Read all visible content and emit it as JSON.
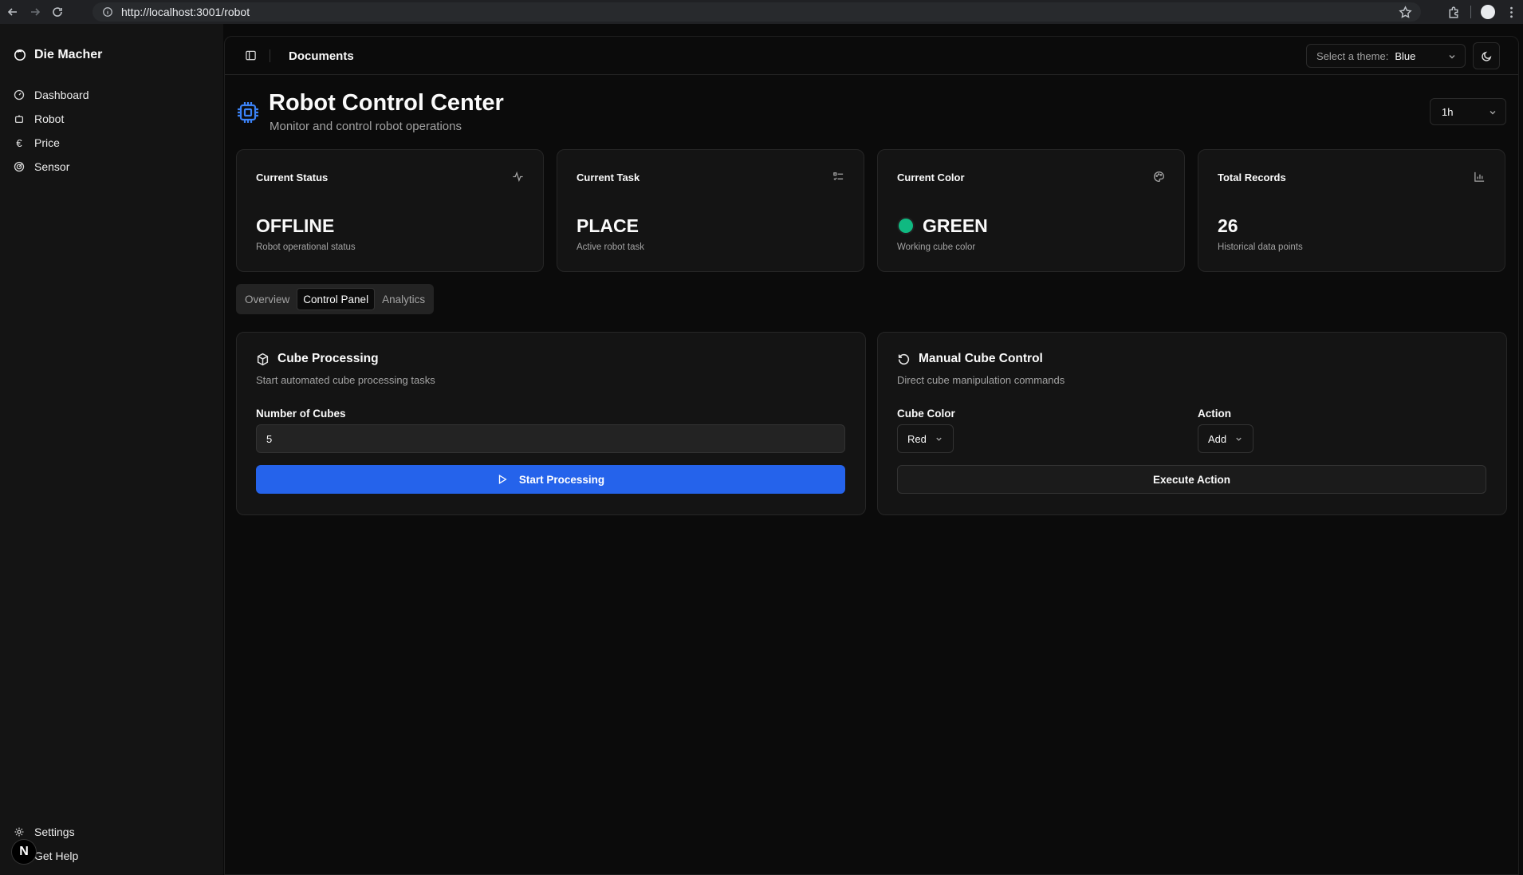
{
  "browser": {
    "url": "http://localhost:3001/robot"
  },
  "sidebar": {
    "brand": "Die Macher",
    "items": [
      {
        "label": "Dashboard",
        "icon": "gauge-icon"
      },
      {
        "label": "Robot",
        "icon": "bot-icon"
      },
      {
        "label": "Price",
        "icon": "euro-icon"
      },
      {
        "label": "Sensor",
        "icon": "radar-icon"
      }
    ],
    "footer": [
      {
        "label": "Settings",
        "icon": "gear-icon"
      },
      {
        "label": "Get Help",
        "icon": "help-icon"
      }
    ],
    "avatar_letter": "N"
  },
  "topbar": {
    "title": "Documents",
    "theme_label": "Select a theme:",
    "theme_value": "Blue"
  },
  "page": {
    "title": "Robot Control Center",
    "subtitle": "Monitor and control robot operations",
    "range": "1h",
    "accent_color": "#3b82f6"
  },
  "stats": [
    {
      "label": "Current Status",
      "value": "OFFLINE",
      "desc": "Robot operational status",
      "icon": "activity-icon"
    },
    {
      "label": "Current Task",
      "value": "PLACE",
      "desc": "Active robot task",
      "icon": "list-checks-icon"
    },
    {
      "label": "Current Color",
      "value": "GREEN",
      "desc": "Working cube color",
      "icon": "palette-icon",
      "dot_color": "#10b981"
    },
    {
      "label": "Total Records",
      "value": "26",
      "desc": "Historical data points",
      "icon": "bar-chart-icon"
    }
  ],
  "tabs": [
    {
      "label": "Overview",
      "active": false
    },
    {
      "label": "Control Panel",
      "active": true
    },
    {
      "label": "Analytics",
      "active": false
    }
  ],
  "cube_processing": {
    "title": "Cube Processing",
    "subtitle": "Start automated cube processing tasks",
    "field_label": "Number of Cubes",
    "field_value": "5",
    "button_label": "Start Processing"
  },
  "manual_control": {
    "title": "Manual Cube Control",
    "subtitle": "Direct cube manipulation commands",
    "color_label": "Cube Color",
    "color_value": "Red",
    "action_label": "Action",
    "action_value": "Add",
    "button_label": "Execute Action"
  }
}
